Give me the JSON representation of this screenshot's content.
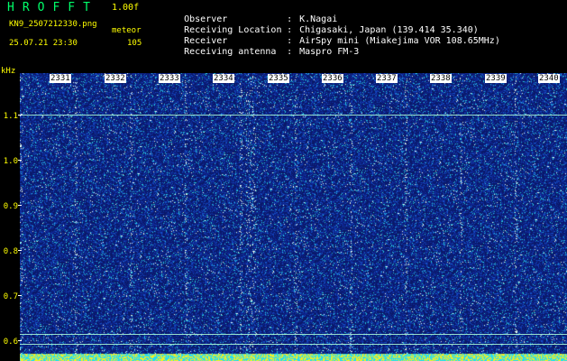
{
  "header": {
    "app_title": "HROFFT",
    "version": "1.00f",
    "filename": "KN9_2507212330.png",
    "mode": "meteor",
    "datetime": "25.07.21 23:30",
    "count": "105"
  },
  "meta": [
    {
      "label": "Observer",
      "value": "K.Nagai"
    },
    {
      "label": "Receiving Location",
      "value": "Chigasaki, Japan (139.414 35.340)"
    },
    {
      "label": "Receiver",
      "value": "AirSpy mini (Miakejima VOR 108.65MHz)"
    },
    {
      "label": "Receiving antenna",
      "value": "Maspro FM-3"
    }
  ],
  "axis": {
    "y_unit": "kHz",
    "y_ticks": [
      "1.1",
      "1.0",
      "0.9",
      "0.8",
      "0.7",
      "0.6"
    ],
    "x_ticks": [
      "2331",
      "2332",
      "2333",
      "2334",
      "2335",
      "2336",
      "2337",
      "2338",
      "2339",
      "2340"
    ]
  },
  "colors": {
    "background": "#000000",
    "waterfall": "#0e1f7c",
    "title": "#00ff6a",
    "labels": "#ffff00"
  }
}
